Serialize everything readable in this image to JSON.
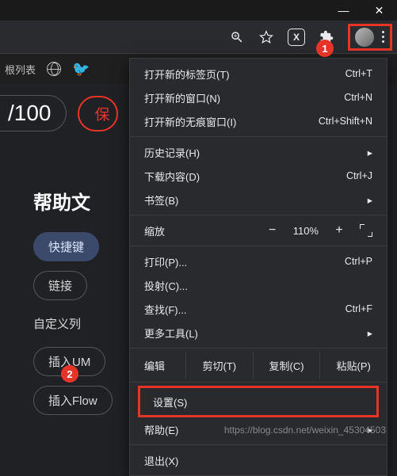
{
  "window": {
    "min": "—",
    "close": "✕"
  },
  "toolbar": {
    "ext_letter": "X"
  },
  "tabbar": {
    "label": "根列表"
  },
  "page": {
    "counter": "/100",
    "save": "保",
    "help_title": "帮助文",
    "chips": {
      "hotkey": "快捷键",
      "link": "链接",
      "custom": "自定义列",
      "uml": "插入UM",
      "flow": "插入Flow"
    }
  },
  "menu": {
    "new_tab": {
      "label": "打开新的标签页(T)",
      "shortcut": "Ctrl+T"
    },
    "new_window": {
      "label": "打开新的窗口(N)",
      "shortcut": "Ctrl+N"
    },
    "new_incognito": {
      "label": "打开新的无痕窗口(I)",
      "shortcut": "Ctrl+Shift+N"
    },
    "history": {
      "label": "历史记录(H)"
    },
    "downloads": {
      "label": "下载内容(D)",
      "shortcut": "Ctrl+J"
    },
    "bookmarks": {
      "label": "书签(B)"
    },
    "zoom": {
      "label": "缩放",
      "minus": "−",
      "value": "110%",
      "plus": "+"
    },
    "print": {
      "label": "打印(P)...",
      "shortcut": "Ctrl+P"
    },
    "cast": {
      "label": "投射(C)..."
    },
    "find": {
      "label": "查找(F)...",
      "shortcut": "Ctrl+F"
    },
    "more_tools": {
      "label": "更多工具(L)"
    },
    "edit": {
      "label": "编辑",
      "cut": "剪切(T)",
      "copy": "复制(C)",
      "paste": "粘贴(P)"
    },
    "settings": {
      "label": "设置(S)"
    },
    "help": {
      "label": "帮助(E)"
    },
    "exit": {
      "label": "退出(X)"
    }
  },
  "callouts": {
    "one": "1",
    "two": "2"
  },
  "watermark": "https://blog.csdn.net/weixin_45304503"
}
